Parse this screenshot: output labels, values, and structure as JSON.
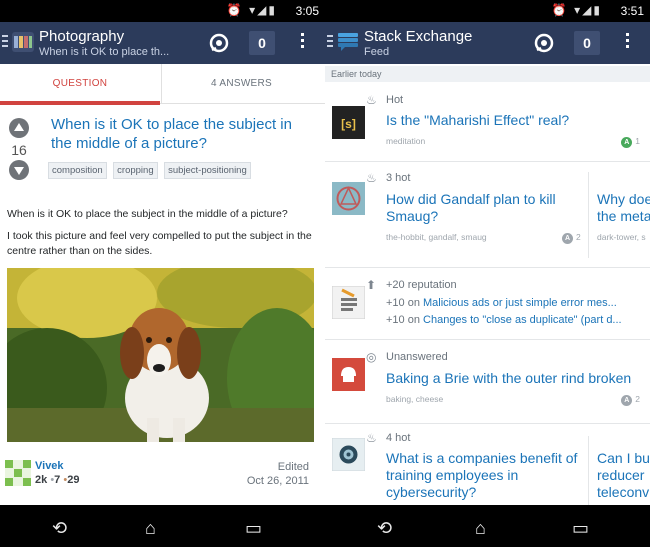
{
  "left": {
    "status_time": "3:05",
    "site_title": "Photography",
    "site_subtitle": "When is it OK to place th...",
    "inbox_count": "0",
    "tabs": {
      "question": "QUESTION",
      "answers": "4 ANSWERS"
    },
    "question": {
      "title": "When is it OK to place the subject in the middle of a picture?",
      "score": "16",
      "tags": [
        "composition",
        "cropping",
        "subject-positioning"
      ],
      "body": [
        "When is it OK to place the subject in the middle of a picture?",
        "I took this picture and feel very compelled to put the subject in the centre rather than on the sides."
      ]
    },
    "author": {
      "name": "Vivek",
      "rep": "2k",
      "silver": "7",
      "bronze": "29",
      "edited_label": "Edited",
      "date": "Oct 26, 2011"
    }
  },
  "right": {
    "status_time": "3:51",
    "site_title": "Stack Exchange",
    "site_subtitle": "Feed",
    "inbox_count": "0",
    "section_header": "Earlier today",
    "items": [
      {
        "kind": "Hot",
        "title": "Is the \"Maharishi Effect\" real?",
        "meta": "meditation",
        "count": "1",
        "thumb_text": "[s]"
      },
      {
        "kind": "3 hot",
        "title": "How did Gandalf plan to kill Smaug?",
        "meta": "the-hobbit, gandalf, smaug",
        "count": "2",
        "peek_title_1": "Why doe",
        "peek_title_2": "the meta",
        "peek_meta": "dark-tower, s"
      },
      {
        "kind": "+20 reputation",
        "line1_prefix": "+10 on ",
        "line1_link": "Malicious ads or just simple error mes...",
        "line2_prefix": "+10 on ",
        "line2_link": "Changes to \"close as duplicate\" (part d..."
      },
      {
        "kind": "Unanswered",
        "title": "Baking a Brie with the outer rind broken",
        "meta": "baking, cheese",
        "count": "2"
      },
      {
        "kind": "4 hot",
        "title": "What is a companies benefit of training employees in cybersecurity?",
        "peek_title_1": "Can I bu",
        "peek_title_2": "reducer",
        "peek_title_3": "teleconv"
      }
    ]
  },
  "colors": {
    "appbar": "#2c3b5b",
    "link": "#1b74b8",
    "accent_red": "#d1433f"
  }
}
